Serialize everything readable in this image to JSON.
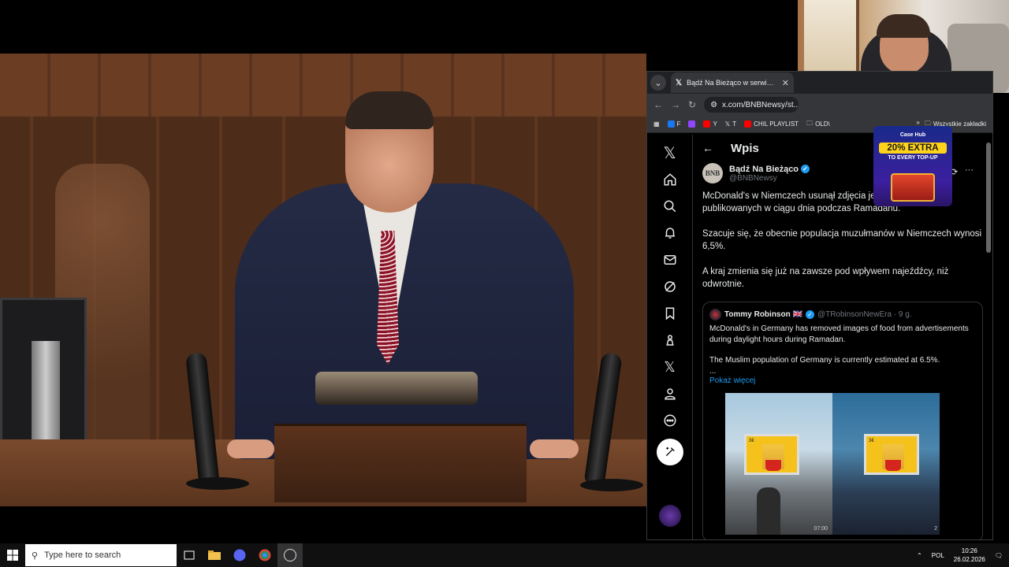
{
  "browser": {
    "tab_title": "Bądź Na Bieżąco w serwisie X: ...",
    "url": "x.com/BNBNewsy/st...",
    "bookmarks": [
      "F",
      "Y",
      "T",
      "CHIL PLAYLIST",
      "OLD\\"
    ],
    "bookmarks_all": "Wszystkie zakładki"
  },
  "x": {
    "header_title": "Wpis",
    "author_name": "Bądź Na Bieżąco",
    "author_handle": "@BNBNewsy",
    "logo_text": "BNB",
    "tweet_paragraphs": [
      "McDonald's w Niemczech usunął zdjęcia jedzenia z reklam publikowanych w ciągu dnia podczas Ramadanu.",
      "Szacuje się, że obecnie populacja muzułmanów w Niemczech wynosi 6,5%.",
      "A kraj zmienia się już na zawsze pod wpływem najeźdźcy, niż odwrotnie."
    ],
    "quote": {
      "name": "Tommy Robinson 🇬🇧",
      "handle": "@TRobinsonNewEra · 9 g.",
      "text_1": "McDonald's in Germany has removed images of food from advertisements during daylight hours during Ramadan.",
      "text_2": "The Muslim population of Germany is currently estimated at 6.5%.",
      "ellipsis": "...",
      "more": "Pokaż więcej",
      "media_time": "07:00",
      "media_count": "2",
      "price_l": "3€",
      "price_r": "3€"
    }
  },
  "ad": {
    "brand": "Case Hub",
    "badge": "20% EXTRA",
    "sub": "TO EVERY TOP-UP"
  },
  "taskbar": {
    "search_placeholder": "Type here to search",
    "lang": "POL",
    "time": "10:26",
    "date": "26.02.2026"
  },
  "colors": {
    "accent": "#1d9bf0",
    "x_bg": "#000000",
    "chrome_bar": "#35363a"
  }
}
